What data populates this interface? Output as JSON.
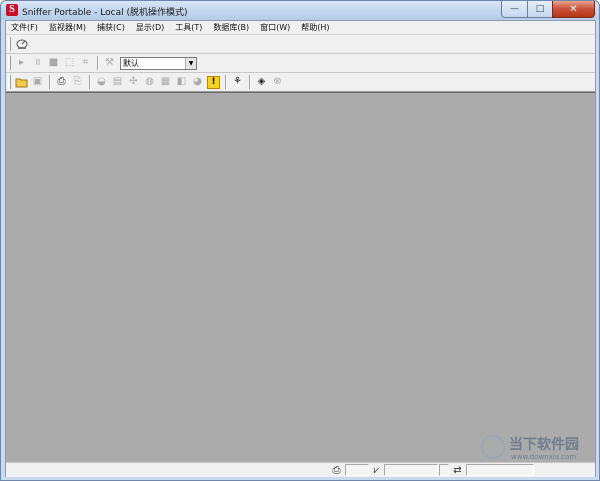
{
  "window": {
    "title": "Sniffer Portable - Local (脱机操作模式)",
    "icon_letter": "S",
    "controls": {
      "minimize": "—",
      "maximize": "□",
      "close": "✕"
    }
  },
  "menubar": {
    "items": [
      {
        "label": "文件(F)"
      },
      {
        "label": "监视器(M)"
      },
      {
        "label": "捕获(C)"
      },
      {
        "label": "显示(D)"
      },
      {
        "label": "工具(T)"
      },
      {
        "label": "数据库(B)"
      },
      {
        "label": "窗口(W)"
      },
      {
        "label": "帮助(H)"
      }
    ]
  },
  "toolbar_monitor": {
    "icons": [
      "dashboard-icon"
    ]
  },
  "toolbar_capture": {
    "buttons": [
      {
        "icon": "play-icon",
        "glyph": "▸"
      },
      {
        "icon": "pause-icon",
        "glyph": "॥"
      },
      {
        "icon": "stop-icon",
        "glyph": "■"
      },
      {
        "icon": "stop-and-display-icon",
        "glyph": "⬚"
      },
      {
        "icon": "display-icon",
        "glyph": "⌗"
      },
      {
        "icon": "define-filter-icon",
        "glyph": "⚒"
      }
    ],
    "filter_select": {
      "value": "默认",
      "arrow": "▼"
    }
  },
  "toolbar_main": {
    "buttons": [
      {
        "icon": "open-folder-icon",
        "glyph": "📂",
        "enabled": true
      },
      {
        "icon": "save-icon",
        "glyph": "▣",
        "enabled": false
      },
      {
        "icon": "print-icon",
        "glyph": "⎙",
        "enabled": true
      },
      {
        "icon": "print-preview-icon",
        "glyph": "⎘",
        "enabled": false
      },
      {
        "icon": "dashboard-icon",
        "glyph": "◒",
        "enabled": false
      },
      {
        "icon": "host-table-icon",
        "glyph": "▤",
        "enabled": false
      },
      {
        "icon": "matrix-icon",
        "glyph": "✣",
        "enabled": false
      },
      {
        "icon": "application-response-icon",
        "glyph": "◍",
        "enabled": false
      },
      {
        "icon": "history-samples-icon",
        "glyph": "▦",
        "enabled": false
      },
      {
        "icon": "protocol-distribution-icon",
        "glyph": "◧",
        "enabled": false
      },
      {
        "icon": "global-statistics-icon",
        "glyph": "◕",
        "enabled": false
      },
      {
        "icon": "alarm-log-icon",
        "glyph": "!",
        "enabled": true,
        "style": "warn"
      },
      {
        "icon": "address-book-icon",
        "glyph": "⚘",
        "enabled": true
      },
      {
        "icon": "expert-icon",
        "glyph": "◈",
        "enabled": true
      },
      {
        "icon": "go-icon",
        "glyph": "⊗",
        "enabled": false
      }
    ]
  },
  "statusbar": {
    "printer_icon_glyph": "⎙",
    "capture_icon_glyph": "⩗",
    "network_icon_glyph": "⇄"
  },
  "watermark": {
    "title": "当下软件园",
    "url": "www.downxia.com"
  }
}
